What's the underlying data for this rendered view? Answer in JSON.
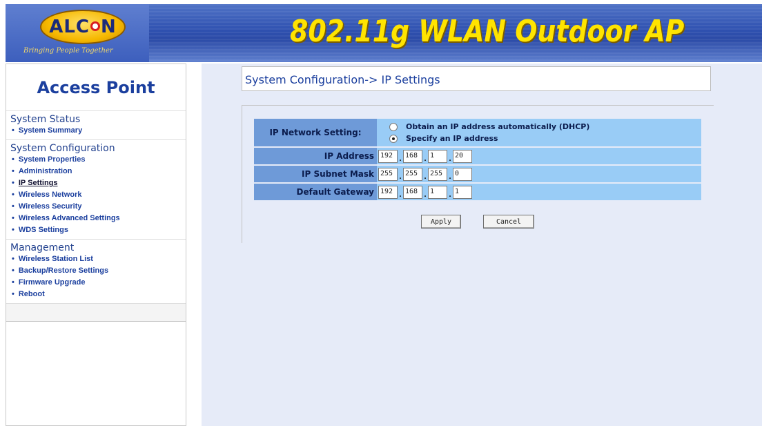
{
  "header": {
    "logo_text_left": "ALC",
    "logo_text_right": "N",
    "tagline": "Bringing People Together",
    "product_title": "802.11g WLAN Outdoor AP"
  },
  "sidebar": {
    "title": "Access Point",
    "sections": [
      {
        "title": "System Status",
        "items": [
          {
            "label": "System Summary"
          }
        ]
      },
      {
        "title": "System Configuration",
        "items": [
          {
            "label": "System Properties"
          },
          {
            "label": "Administration"
          },
          {
            "label": "IP Settings",
            "active": true
          },
          {
            "label": "Wireless Network"
          },
          {
            "label": "Wireless Security"
          },
          {
            "label": "Wireless Advanced Settings"
          },
          {
            "label": "WDS Settings"
          }
        ]
      },
      {
        "title": "Management",
        "items": [
          {
            "label": "Wireless Station List"
          },
          {
            "label": "Backup/Restore Settings"
          },
          {
            "label": "Firmware Upgrade"
          },
          {
            "label": "Reboot"
          }
        ]
      }
    ]
  },
  "main": {
    "breadcrumb": "System Configuration-> IP Settings",
    "ip_network_setting_label": "IP Network Setting:",
    "dhcp_option": "Obtain an IP address automatically (DHCP)",
    "static_option": "Specify an IP address",
    "selected_option": "static",
    "ip_address_label": "IP Address",
    "ip_address": [
      "192",
      "168",
      "1",
      "20"
    ],
    "subnet_mask_label": "IP Subnet Mask",
    "subnet_mask": [
      "255",
      "255",
      "255",
      "0"
    ],
    "gateway_label": "Default Gateway",
    "gateway": [
      "192",
      "168",
      "1",
      "1"
    ],
    "apply_label": "Apply",
    "cancel_label": "Cancel"
  },
  "colors": {
    "header_blue": "#2f51b0",
    "title_yellow": "#ffe400",
    "label_blue": "#6e9ad8",
    "value_blue": "#99ccf6",
    "main_bg": "#e6ebf8"
  }
}
